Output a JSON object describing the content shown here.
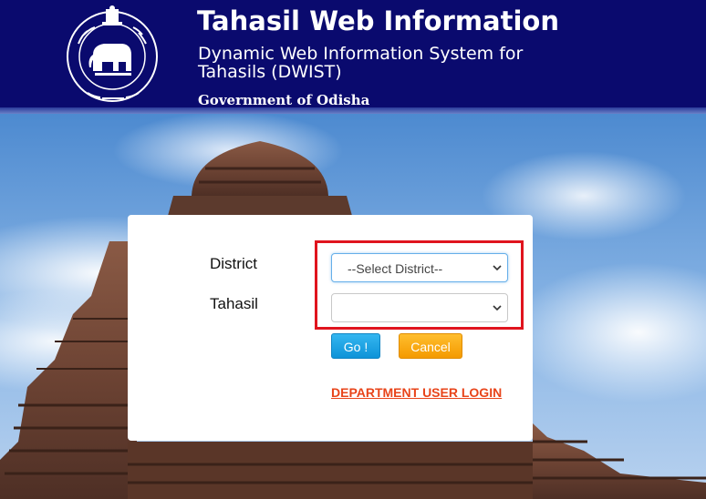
{
  "header": {
    "title": "Tahasil Web Information",
    "subtitle": "Dynamic Web Information System for Tahasils (DWIST)",
    "government": "Government of Odisha"
  },
  "form": {
    "district_label": "District",
    "district_value": "--Select District--",
    "tahasil_label": "Tahasil",
    "tahasil_value": "",
    "go_label": "Go !",
    "cancel_label": "Cancel",
    "dept_login_label": "DEPARTMENT USER LOGIN"
  },
  "colors": {
    "header_bg": "#0a0a6e",
    "go_button": "#1ea6e6",
    "cancel_button": "#f7a80d",
    "link": "#e8441a",
    "highlight_box": "#e0141e"
  }
}
